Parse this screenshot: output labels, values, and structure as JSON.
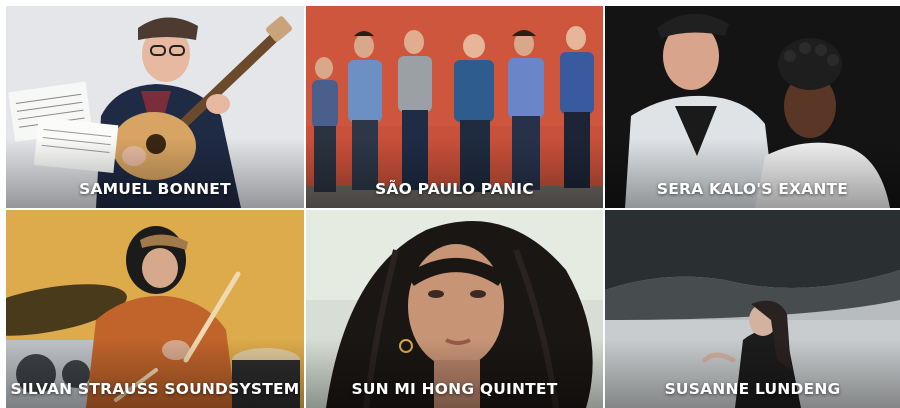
{
  "artists": [
    {
      "name": "SAMUEL BONNET",
      "photo": "portrait-guitarist-with-sheet-music"
    },
    {
      "name": "SÃO PAULO PANIC",
      "photo": "band-against-red-wall"
    },
    {
      "name": "SERA KALO'S EXANTE",
      "photo": "duo-portrait-dark-background"
    },
    {
      "name": "SILVAN STRAUSS SOUNDSYSTEM",
      "photo": "drummer-in-studio"
    },
    {
      "name": "SUN MI HONG QUINTET",
      "photo": "woman-portrait-looking-up"
    },
    {
      "name": "SUSANNE LUNDENG",
      "photo": "woman-by-lake"
    }
  ],
  "colors": {
    "text": "#ffffff",
    "bg": "#ffffff"
  }
}
